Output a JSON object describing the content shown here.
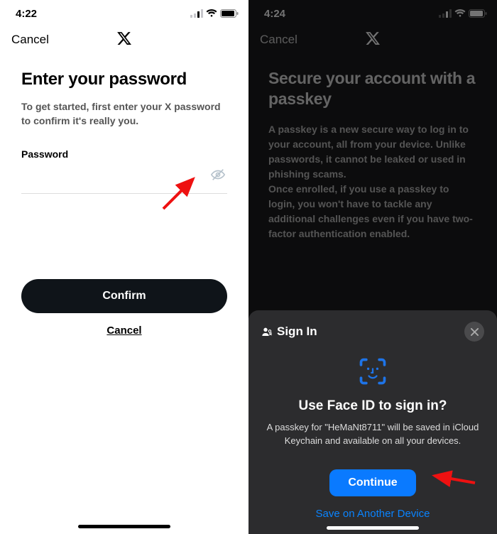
{
  "left": {
    "status_time": "4:22",
    "nav_cancel": "Cancel",
    "heading": "Enter your password",
    "subheading": "To get started, first enter your X password to confirm it's really you.",
    "field_label": "Password",
    "input_value": "",
    "input_placeholder": "",
    "btn_confirm": "Confirm",
    "btn_cancel": "Cancel"
  },
  "right": {
    "status_time": "4:24",
    "nav_cancel": "Cancel",
    "heading": "Secure your account with a passkey",
    "body1": "A passkey is a new secure way to log in to your account, all from your device. Unlike passwords, it cannot be leaked or used in phishing scams.",
    "body2": "Once enrolled, if you use a passkey to login, you won't have to tackle any additional challenges even if you have two-factor authentication enabled.",
    "sheet": {
      "header": "Sign In",
      "faceid_title": "Use Face ID to sign in?",
      "faceid_desc_pre": "A passkey for \"",
      "username": "HeMaNt8711",
      "faceid_desc_post": "\" will be saved in iCloud Keychain and available on all your devices.",
      "btn_continue": "Continue",
      "save_other": "Save on Another Device"
    }
  },
  "colors": {
    "accent_blue": "#0a7aff"
  }
}
